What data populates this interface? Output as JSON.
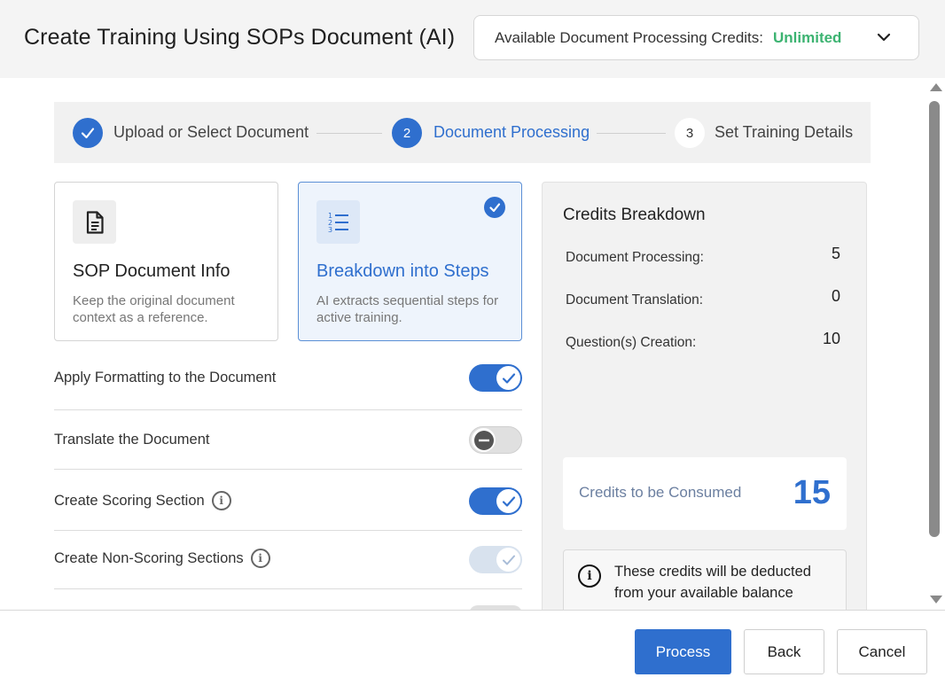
{
  "header": {
    "title": "Create Training Using SOPs Document (AI)",
    "credits_label": "Available Document Processing Credits:",
    "credits_value": "Unlimited",
    "credits_color": "#3cb371"
  },
  "stepper": {
    "steps": [
      {
        "number": "",
        "label": "Upload or Select Document",
        "state": "completed"
      },
      {
        "number": "2",
        "label": "Document Processing",
        "state": "active"
      },
      {
        "number": "3",
        "label": "Set Training Details",
        "state": "upcoming"
      }
    ]
  },
  "cards": [
    {
      "title": "SOP Document Info",
      "description": "Keep the original document context as a reference.",
      "icon": "document-icon",
      "selected": false
    },
    {
      "title": "Breakdown into Steps",
      "description": "AI extracts sequential steps for active training.",
      "icon": "numbered-list-icon",
      "selected": true
    }
  ],
  "options": [
    {
      "label": "Apply Formatting to the Document",
      "state": "on",
      "info": false
    },
    {
      "label": "Translate the Document",
      "state": "off",
      "info": false
    },
    {
      "label": "Create Scoring Section",
      "state": "on",
      "info": true
    },
    {
      "label": "Create Non-Scoring Sections",
      "state": "disabled-on",
      "info": true
    }
  ],
  "credits_panel": {
    "title": "Credits Breakdown",
    "rows": [
      {
        "label": "Document Processing:",
        "value": "5"
      },
      {
        "label": "Document Translation:",
        "value": "0"
      },
      {
        "label": "Question(s) Creation:",
        "value": "10"
      }
    ],
    "consume_label": "Credits to be Consumed",
    "consume_value": "15",
    "note": "These credits will be deducted from your available balance"
  },
  "footer": {
    "process_label": "Process",
    "back_label": "Back",
    "cancel_label": "Cancel"
  },
  "accent_color": "#2f6fce"
}
